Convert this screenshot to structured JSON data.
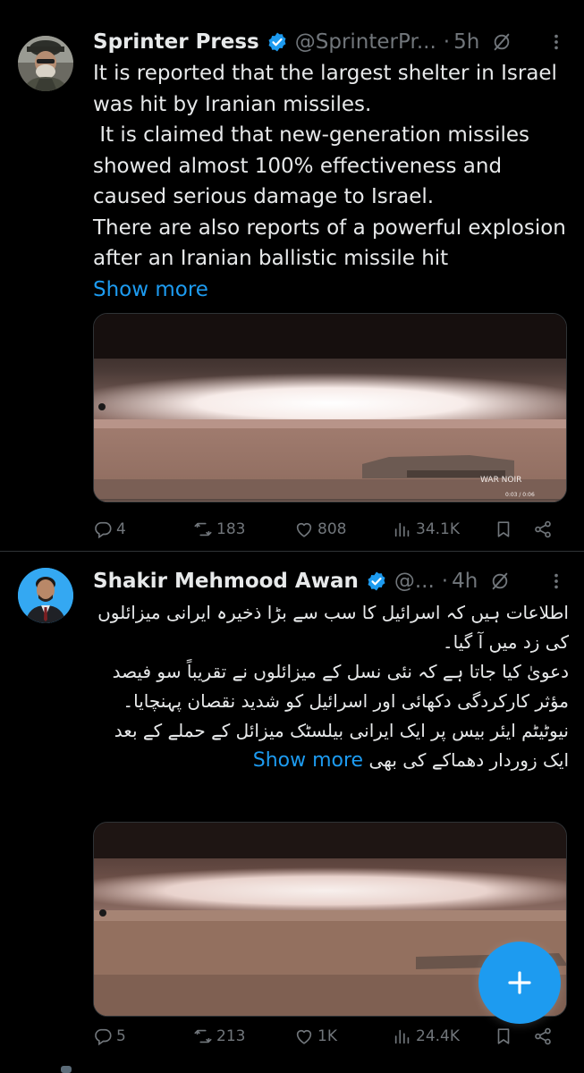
{
  "colors": {
    "accent": "#1d9bf0",
    "background": "#000000",
    "text": "#e7e9ea",
    "muted": "#71767b"
  },
  "tweets": [
    {
      "author": "Sprinter Press",
      "handle": "@SprinterPr...",
      "time": "5h",
      "dot": "·",
      "body_lines": [
        "It is reported that the largest shelter in Israel was hit by Iranian missiles.",
        " It is claimed that new-generation missiles showed almost 100% effectiveness and caused serious damage to Israel.",
        "There are also reports of a powerful explosion after an Iranian ballistic missile hit"
      ],
      "show_more": "Show more",
      "media": {
        "watermark": "WAR NOIR",
        "video_time": "0:03 / 0:06"
      },
      "replies": "4",
      "reposts": "183",
      "likes": "808",
      "views": "34.1K"
    },
    {
      "author": "Shakir Mehmood Awan",
      "handle": "@...",
      "time": "4h",
      "dot": "·",
      "body_lines": [
        "اطلاعات ہیں کہ اسرائیل کا سب سے بڑا ذخیرہ ایرانی میزائلوں کی زد میں آ گیا۔",
        "دعویٰ کیا جاتا ہے کہ نئی نسل کے میزائلوں نے تقریباً سو فیصد مؤثر کارکردگی دکھائی اور اسرائیل کو شدید نقصان پہنچایا۔",
        "نیوٹیٹم ایئر بیس پر ایک ایرانی بیلسٹک میزائل کے حملے کے بعد ایک زوردار دھماکے کی بھی"
      ],
      "show_more": "Show more",
      "replies": "5",
      "reposts": "213",
      "likes": "1K",
      "views": "24.4K"
    }
  ],
  "icons": [
    "verified-icon",
    "grok-icon",
    "more-icon",
    "reply-icon",
    "repost-icon",
    "like-icon",
    "views-icon",
    "bookmark-icon",
    "share-icon",
    "compose-plus-icon"
  ]
}
